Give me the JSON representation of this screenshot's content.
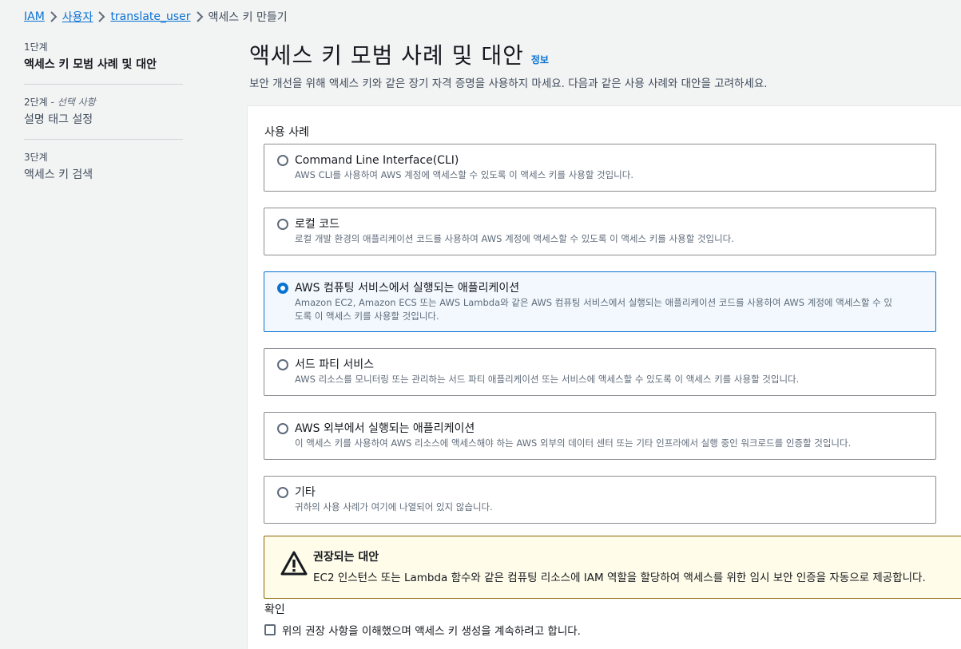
{
  "breadcrumb": {
    "items": [
      "IAM",
      "사용자",
      "translate_user"
    ],
    "current": "액세스 키 만들기"
  },
  "steps": [
    {
      "number": "1단계",
      "optional": "",
      "title": "액세스 키 모범 사례 및 대안"
    },
    {
      "number": "2단계",
      "optional": "- 선택 사항",
      "title": "설명 태그 설정"
    },
    {
      "number": "3단계",
      "optional": "",
      "title": "액세스 키 검색"
    }
  ],
  "header": {
    "title": "액세스 키 모범 사례 및 대안",
    "info": "정보",
    "description": "보안 개선을 위해 액세스 키와 같은 장기 자격 증명을 사용하지 마세요. 다음과 같은 사용 사례와 대안을 고려하세요."
  },
  "use_case": {
    "label": "사용 사례",
    "selected_index": 2,
    "options": [
      {
        "title": "Command Line Interface(CLI)",
        "desc": "AWS CLI를 사용하여 AWS 계정에 액세스할 수 있도록 이 액세스 키를 사용할 것입니다.",
        "desc2": ""
      },
      {
        "title": "로컬 코드",
        "desc": "로컬 개발 환경의 애플리케이션 코드를 사용하여 AWS 계정에 액세스할 수 있도록 이 액세스 키를 사용할 것입니다.",
        "desc2": ""
      },
      {
        "title": "AWS 컴퓨팅 서비스에서 실행되는 애플리케이션",
        "desc": "Amazon EC2, Amazon ECS 또는 AWS Lambda와 같은 AWS 컴퓨팅 서비스에서 실행되는 애플리케이션 코드를 사용하여 AWS 계정에 액세스할 수 있",
        "desc2": "도록 이 액세스 키를 사용할 것입니다."
      },
      {
        "title": "서드 파티 서비스",
        "desc": "AWS 리소스를 모니터링 또는 관리하는 서드 파티 애플리케이션 또는 서비스에 액세스할 수 있도록 이 액세스 키를 사용할 것입니다.",
        "desc2": ""
      },
      {
        "title": "AWS 외부에서 실행되는 애플리케이션",
        "desc": "이 액세스 키를 사용하여 AWS 리소스에 액세스해야 하는 AWS 외부의 데이터 센터 또는 기타 인프라에서 실행 중인 워크로드를 인증할 것입니다.",
        "desc2": ""
      },
      {
        "title": "기타",
        "desc": "귀하의 사용 사례가 여기에 나열되어 있지 않습니다.",
        "desc2": ""
      }
    ]
  },
  "alert": {
    "title": "권장되는 대안",
    "text": "EC2 인스턴스 또는 Lambda 함수와 같은 컴퓨팅 리소스에 IAM 역할을 할당하여 액세스를 위한 임시 보안 인증을 자동으로 제공합니다.",
    "icon": "warning-icon"
  },
  "confirm": {
    "label": "확인",
    "checkbox_text": "위의 권장 사항을 이해했으며 액세스 키 생성을 계속하려고 합니다.",
    "checked": false
  },
  "colors": {
    "link": "#0972d3",
    "selected_bg": "#f2f8fd",
    "alert_bg": "#fffce9",
    "alert_border": "#8d6605"
  }
}
